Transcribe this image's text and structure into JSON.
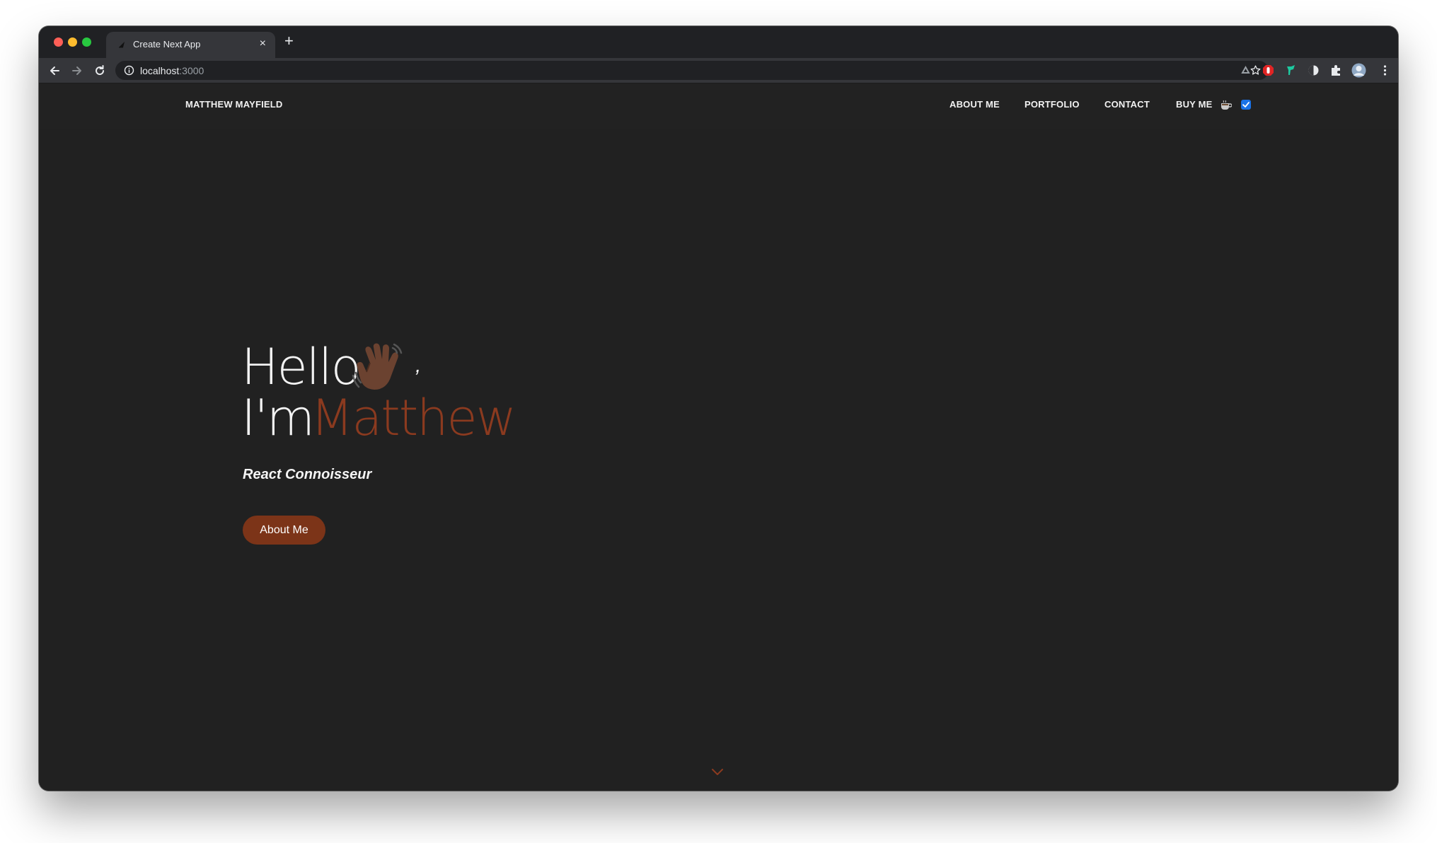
{
  "browser": {
    "tab_title": "Create Next App",
    "tab_close": "×",
    "new_tab": "+",
    "url_host": "localhost",
    "url_port": ":3000"
  },
  "site": {
    "brand": "MATTHEW MAYFIELD",
    "nav": {
      "about": "ABOUT ME",
      "portfolio": "PORTFOLIO",
      "contact": "CONTACT",
      "buy": "BUY ME"
    },
    "hero": {
      "hello": "Hello",
      "comma": ",",
      "im": "I'm",
      "name": "Matthew",
      "subtitle": "React Connoisseur",
      "button": "About Me"
    }
  },
  "colors": {
    "accent": "#8b3a1f",
    "button": "#7c3418",
    "background": "#212121",
    "toggle": "#1a73e8"
  },
  "icons": {
    "wave": "waving-hand-icon",
    "coffee": "coffee-cup-icon",
    "scroll": "chevron-down-icon"
  }
}
